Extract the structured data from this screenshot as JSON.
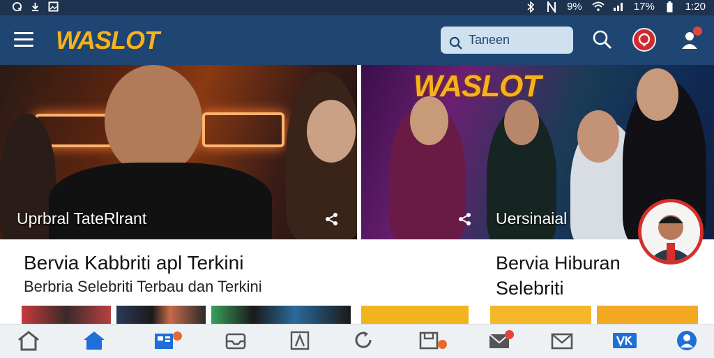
{
  "status_bar": {
    "left_icons": [
      "q-icon",
      "download-icon",
      "image-icon"
    ],
    "bluetooth_icon": "bluetooth-icon",
    "signal_text": "9%",
    "battery_text": "17%",
    "time": "1:20"
  },
  "header": {
    "logo": "WASLOT",
    "search_placeholder": "Taneen"
  },
  "hero": {
    "left_caption": "Uprbral TateRlrant",
    "right_logo": "WASLOT",
    "right_caption": "Uersinaial"
  },
  "headlines": {
    "main_title": "Bervia Kabbriti apl Terkini",
    "main_subtitle": "Berbria Selebriti Terbau dan Terkini",
    "right_title": "Bervia Hiburan Selebriti"
  },
  "colors": {
    "status_bar": "#1d3350",
    "header": "#1f4572",
    "logo": "#f5b21d",
    "accent_red": "#d62e2a",
    "nav_active": "#1e6fd9"
  },
  "bottom_nav": [
    {
      "icon": "home-icon"
    },
    {
      "icon": "home-active-icon"
    },
    {
      "icon": "news-icon"
    },
    {
      "icon": "inbox-icon"
    },
    {
      "icon": "text-icon"
    },
    {
      "icon": "refresh-icon"
    },
    {
      "icon": "folder-icon"
    },
    {
      "icon": "mail-icon"
    },
    {
      "icon": "envelope-icon"
    },
    {
      "icon": "vk-icon"
    },
    {
      "icon": "profile-icon"
    }
  ]
}
